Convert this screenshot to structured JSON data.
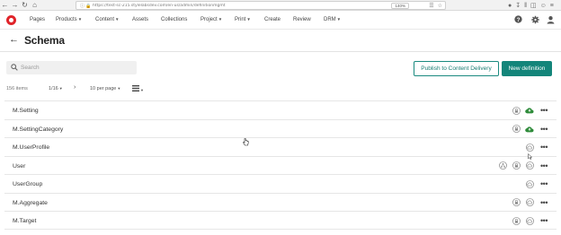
{
  "browser": {
    "url": "https://test-sc-215.stylelabsdev.com/en-us/admin/definitionmgmt",
    "zoom": "140%"
  },
  "nav": {
    "items": [
      {
        "label": "Pages",
        "caret": false
      },
      {
        "label": "Products",
        "caret": true
      },
      {
        "label": "Content",
        "caret": true
      },
      {
        "label": "Assets",
        "caret": false
      },
      {
        "label": "Collections",
        "caret": false
      },
      {
        "label": "Project",
        "caret": true
      },
      {
        "label": "Print",
        "caret": true
      },
      {
        "label": "Create",
        "caret": false
      },
      {
        "label": "Review",
        "caret": false
      },
      {
        "label": "DRM",
        "caret": true
      }
    ]
  },
  "page": {
    "title": "Schema"
  },
  "toolbar": {
    "search_placeholder": "Search",
    "publish_label": "Publish to Content Delivery",
    "new_definition_label": "New definition"
  },
  "pager": {
    "count": "156 items",
    "page": "1/16",
    "per_page": "10 per page"
  },
  "rows": [
    {
      "name": "M.Setting",
      "icons": [
        "lock-icon",
        "cloud-published-icon"
      ]
    },
    {
      "name": "M.SettingCategory",
      "icons": [
        "lock-icon",
        "cloud-published-icon"
      ]
    },
    {
      "name": "M.UserProfile",
      "icons": [
        "cloud-unpublished-icon"
      ]
    },
    {
      "name": "User",
      "icons": [
        "share-icon",
        "lock-icon",
        "cloud-unpublished-icon"
      ]
    },
    {
      "name": "UserGroup",
      "icons": [
        "cloud-unpublished-icon"
      ]
    },
    {
      "name": "M.Aggregate",
      "icons": [
        "lock-icon",
        "cloud-unpublished-icon"
      ]
    },
    {
      "name": "M.Target",
      "icons": [
        "lock-icon",
        "cloud-unpublished-icon"
      ]
    }
  ],
  "colors": {
    "brand_red": "#e0242a",
    "accent_teal": "#13857a",
    "published_green": "#2e8b3a",
    "icon_grey": "#8a8a8a"
  }
}
